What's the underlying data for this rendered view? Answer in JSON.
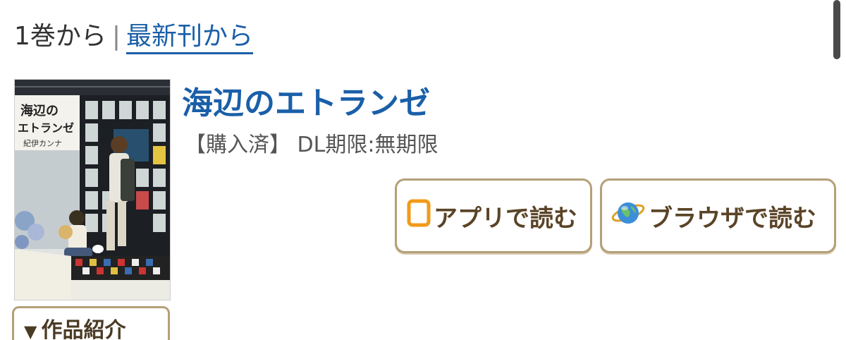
{
  "sort": {
    "from_first": "1巻から",
    "separator": "|",
    "from_latest": "最新刊から"
  },
  "book": {
    "title": "海辺のエトランゼ",
    "status": "【購入済】 DL期限:無期限",
    "cover_title": "海辺のエトランゼ",
    "cover_author": "紀伊カンナ"
  },
  "buttons": {
    "app_read": "アプリで読む",
    "browser_read": "ブラウザで読む",
    "synopsis": "作品紹介"
  },
  "icons": {
    "app": "tablet-icon",
    "browser": "globe-icon",
    "synopsis_toggle": "triangle-down-icon"
  },
  "colors": {
    "link": "#1a5fa8",
    "button_border": "#b59f78",
    "button_text": "#5a4427",
    "app_icon": "#f29a1a"
  }
}
